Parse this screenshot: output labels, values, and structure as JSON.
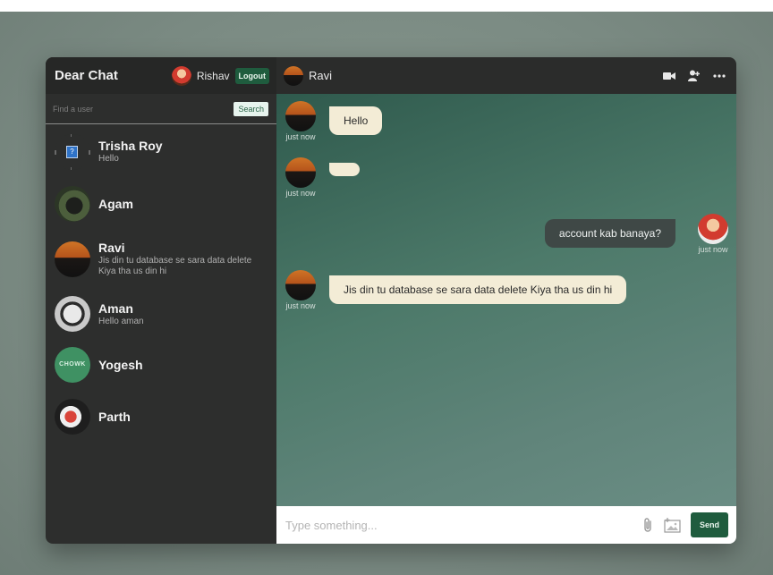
{
  "app": {
    "title": "Dear Chat",
    "current_user": "Rishav",
    "logout_label": "Logout"
  },
  "search": {
    "placeholder": "Find a user",
    "button_label": "Search"
  },
  "users": [
    {
      "name": "Trisha Roy",
      "last_message": "Hello"
    },
    {
      "name": "Agam",
      "last_message": ""
    },
    {
      "name": "Ravi",
      "last_message": "Jis din tu database se sara data delete Kiya tha us din hi"
    },
    {
      "name": "Aman",
      "last_message": "Hello aman"
    },
    {
      "name": "Yogesh",
      "last_message": "",
      "avatar_text": "CHOWK"
    },
    {
      "name": "Parth",
      "last_message": ""
    }
  ],
  "chat": {
    "contact_name": "Ravi",
    "icons": [
      "video-camera-icon",
      "add-user-icon",
      "more-icon"
    ],
    "messages": [
      {
        "from": "Ravi",
        "text": "Hello",
        "time": "just now"
      },
      {
        "from": "Ravi",
        "text": "",
        "time": "just now"
      },
      {
        "from": "Rishav",
        "text": "account kab banaya?",
        "time": "just now"
      },
      {
        "from": "Ravi",
        "text": "Jis din tu database se sara data delete Kiya tha us din hi",
        "time": "just now"
      }
    ]
  },
  "composer": {
    "placeholder": "Type something...",
    "send_label": "Send",
    "icons": [
      "attachment-icon",
      "image-icon"
    ]
  },
  "colors": {
    "accent": "#1f5c3e",
    "sidebar_bg": "#2d2e2d",
    "bubble_received": "#f3ecd6",
    "bubble_sent": "#3f4846"
  }
}
